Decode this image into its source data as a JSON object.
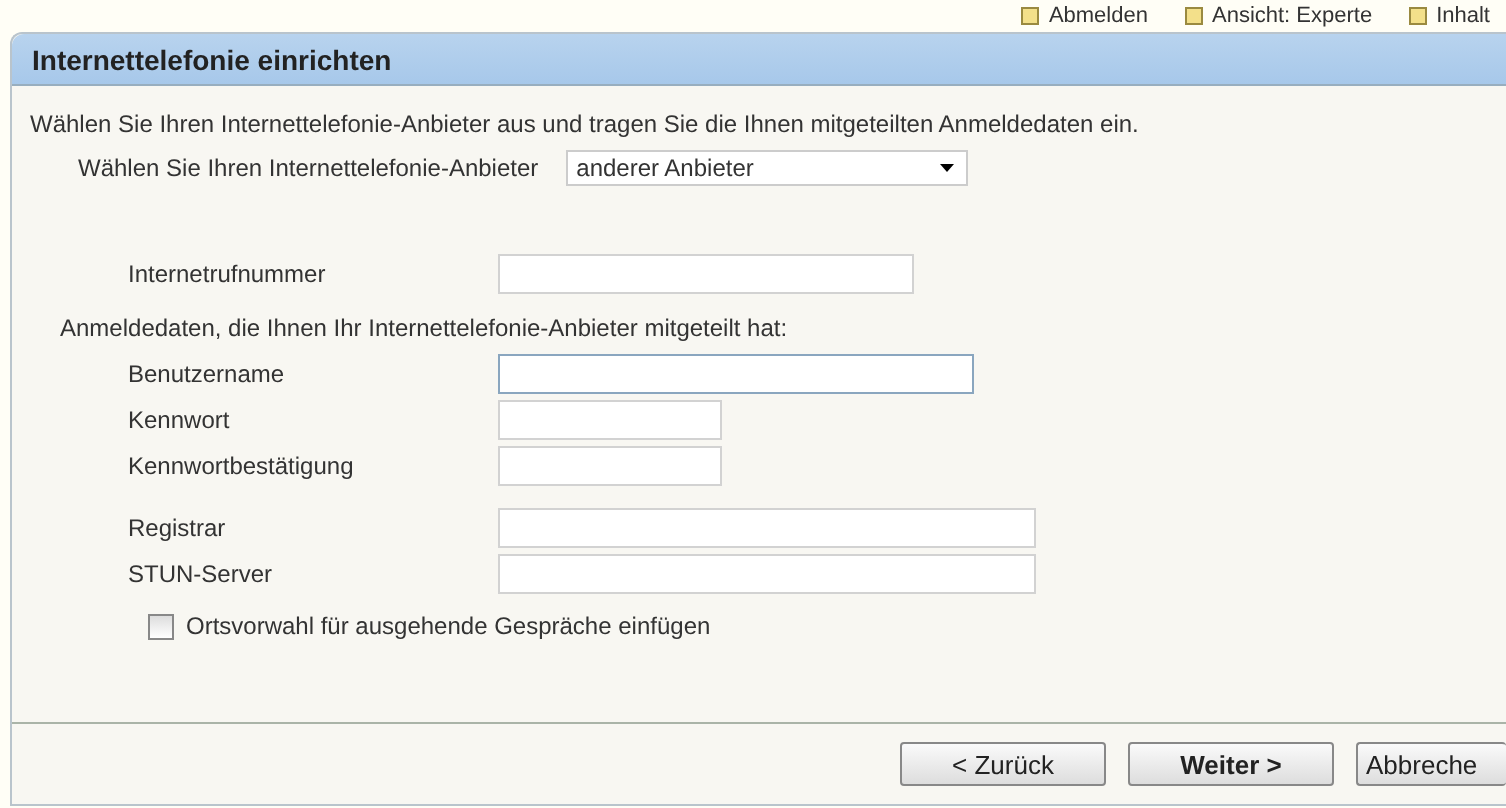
{
  "toolbar": [
    {
      "label": "Abmelden"
    },
    {
      "label": "Ansicht: Experte"
    },
    {
      "label": "Inhalt"
    }
  ],
  "panel": {
    "title": "Internettelefonie einrichten",
    "intro": "Wählen Sie Ihren Internettelefonie-Anbieter aus und tragen Sie die Ihnen mitgeteilten Anmeldedaten ein.",
    "provider": {
      "label": "Wählen Sie Ihren Internettelefonie-Anbieter",
      "value": "anderer Anbieter"
    },
    "number_field": {
      "label": "Internetrufnummer"
    },
    "credentials_note": "Anmeldedaten, die Ihnen Ihr Internettelefonie-Anbieter mitgeteilt hat:",
    "field_groups": [
      [
        {
          "label": "Benutzername",
          "focused": true
        },
        {
          "label": "Kennwort",
          "focused": false
        },
        {
          "label": "Kennwortbestätigung",
          "focused": false
        }
      ],
      [
        {
          "label": "Registrar",
          "focused": false
        },
        {
          "label": "STUN-Server",
          "focused": false
        }
      ]
    ],
    "area_code": {
      "label": "Ortsvorwahl für ausgehende Gespräche einfügen",
      "checked": false
    },
    "buttons": [
      {
        "label": "< Zurück",
        "primary": false
      },
      {
        "label": "Weiter >",
        "primary": true
      },
      {
        "label": "Abbreche",
        "primary": false
      }
    ]
  }
}
